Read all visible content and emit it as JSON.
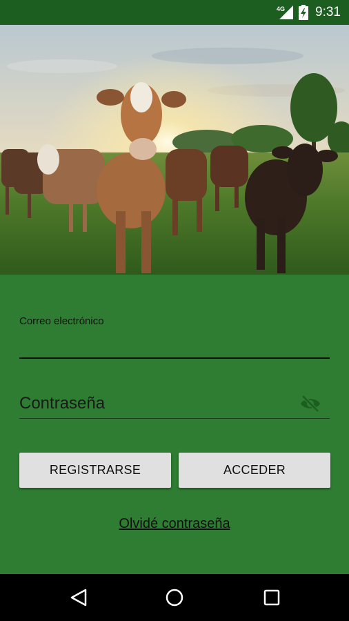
{
  "status_bar": {
    "network": "4G",
    "time": "9:31",
    "icons": [
      "signal-icon",
      "battery-charging-icon"
    ]
  },
  "hero": {
    "image": "cows-in-pasture-at-sunset"
  },
  "form": {
    "email_label": "Correo electrónico",
    "email_value": "",
    "password_placeholder": "Contraseña",
    "password_value": "",
    "password_toggle_icon": "eye-off-icon",
    "register_label": "REGISTRARSE",
    "login_label": "ACCEDER",
    "forgot_label": "Olvidé contraseña"
  },
  "nav_bar": {
    "icons": [
      "back-icon",
      "home-icon",
      "recents-icon"
    ]
  },
  "colors": {
    "status_bar": "#1b5e20",
    "background": "#2e7d32",
    "button": "#e0e0e0",
    "accent_icon": "#1b5e20"
  }
}
